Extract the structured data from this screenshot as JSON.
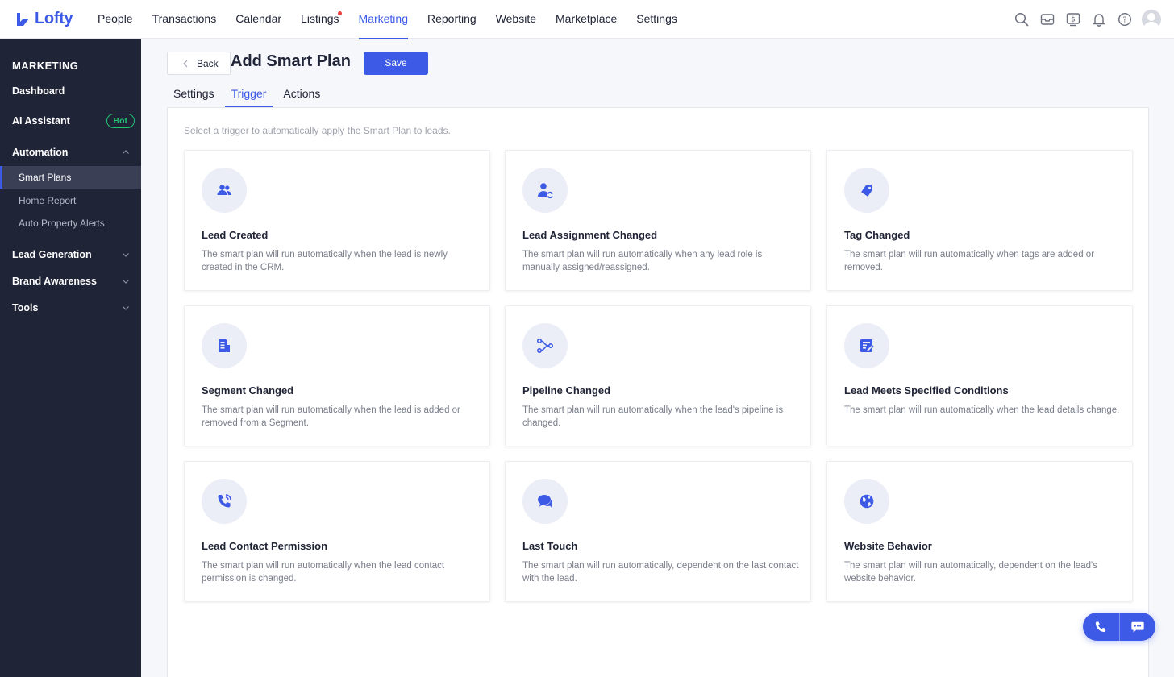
{
  "brand": {
    "name": "Lofty",
    "accent": "#3d5ae6"
  },
  "nav": {
    "items": [
      {
        "label": "People"
      },
      {
        "label": "Transactions"
      },
      {
        "label": "Calendar"
      },
      {
        "label": "Listings",
        "dot": true
      },
      {
        "label": "Marketing",
        "active": true
      },
      {
        "label": "Reporting"
      },
      {
        "label": "Website"
      },
      {
        "label": "Marketplace"
      },
      {
        "label": "Settings"
      }
    ],
    "icons": [
      "search-icon",
      "inbox-icon",
      "billing-icon",
      "bell-icon",
      "help-icon"
    ]
  },
  "sidebar": {
    "title": "MARKETING",
    "dashboard": "Dashboard",
    "ai_assistant": "AI Assistant",
    "ai_badge": "Bot",
    "automation": "Automation",
    "automation_items": [
      "Smart Plans",
      "Home Report",
      "Auto Property Alerts"
    ],
    "lead_generation": "Lead Generation",
    "brand_awareness": "Brand Awareness",
    "tools": "Tools"
  },
  "header": {
    "back_label": "Back",
    "title": "Add Smart Plan",
    "save_label": "Save"
  },
  "tabs": [
    {
      "label": "Settings"
    },
    {
      "label": "Trigger",
      "active": true
    },
    {
      "label": "Actions"
    }
  ],
  "panel": {
    "hint": "Select a trigger to automatically apply the Smart Plan to leads.",
    "triggers": [
      {
        "title": "Lead Created",
        "desc": "The smart plan will run automatically when the lead is newly created in the CRM.",
        "icon": "people-icon"
      },
      {
        "title": "Lead Assignment Changed",
        "desc": "The smart plan will run automatically when any lead role is manually assigned/reassigned.",
        "icon": "user-reassign-icon"
      },
      {
        "title": "Tag Changed",
        "desc": "The smart plan will run automatically when tags are added or removed.",
        "icon": "tag-icon"
      },
      {
        "title": "Segment Changed",
        "desc": "The smart plan will run automatically when the lead is added or removed from a Segment.",
        "icon": "segment-icon"
      },
      {
        "title": "Pipeline Changed",
        "desc": "The smart plan will run automatically when the lead's pipeline is changed.",
        "icon": "pipeline-icon"
      },
      {
        "title": "Lead Meets Specified Conditions",
        "desc": "The smart plan will run automatically when the lead details change.",
        "icon": "conditions-icon"
      },
      {
        "title": "Lead Contact Permission",
        "desc": "The smart plan will run automatically when the lead contact permission is changed.",
        "icon": "phone-permission-icon"
      },
      {
        "title": "Last Touch",
        "desc": "The smart plan will run automatically, dependent on the last contact with the lead.",
        "icon": "chat-bubbles-icon"
      },
      {
        "title": "Website Behavior",
        "desc": "The smart plan will run automatically, dependent on the lead's website behavior.",
        "icon": "globe-icon"
      }
    ]
  },
  "floating": {
    "icons": [
      "phone-icon",
      "chat-icon"
    ]
  }
}
